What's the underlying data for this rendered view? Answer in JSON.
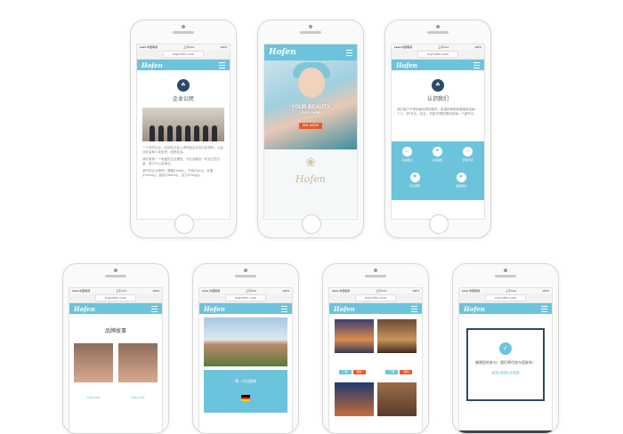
{
  "browser": {
    "time": "上午9:41",
    "carrier": "●●●● 中国联通",
    "battery": "100%",
    "url": "myhofen.com"
  },
  "brand": {
    "logo": "Hofen",
    "accent": "#6cc3dc",
    "navy": "#2d4a66",
    "orange": "#e85a2c"
  },
  "p1": {
    "section_title": "企业公民",
    "para1": "一个好的企业，应该在社会上承担起企业的公民身份，以此对社会和人类负责，回馈社会。",
    "para2": "我们宣扬一个有爱的企业理念，为社会献出一份自己的力量，致力于公益事业。",
    "para3": "我们的企业精神：健康(Health)，开放(Open)，友爱(Friendly)，高效(Efficient)，活力(Energy)。"
  },
  "p2": {
    "hero_text": "YOUR BEAUTY",
    "hero_sub": "OUR CARE",
    "cta": "SEE MORE",
    "footer_logo": "Hofen"
  },
  "p3": {
    "section_title": "认识我们",
    "intro": "我们致力于提供最优质的服务，希望把美丽和健康带给每一个人，将“专业、安全、关爱”的理念贯彻到每一个细节中。",
    "features": [
      "专业团队",
      "关爱理念",
      "舒适环境",
      "安全保障",
      "品质服务"
    ]
  },
  "p4": {
    "section_title": "品牌故事",
    "names": [
      "Jelly kee",
      "Jelly kee"
    ]
  },
  "p5": {
    "caption": "第一代出国旅"
  },
  "p6": {
    "buttons": [
      "了解",
      "预约",
      "了解",
      "预约"
    ]
  },
  "p7": {
    "message": "感谢您的参与！我们将尽快与您联系！",
    "phone": "400-888-9988"
  }
}
